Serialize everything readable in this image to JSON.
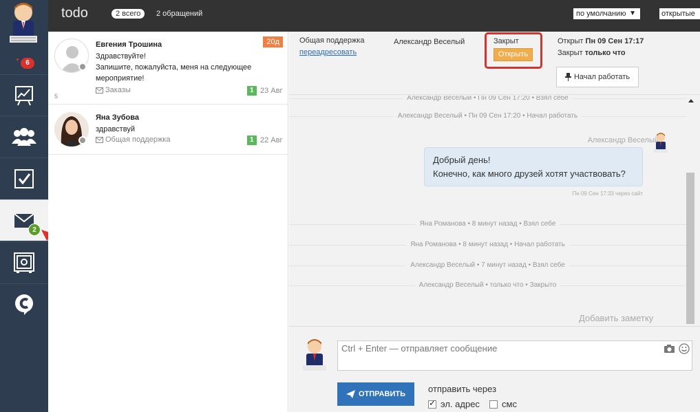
{
  "sidebar": {
    "notifications": "6",
    "mail_badge": "2"
  },
  "topbar": {
    "title": "todo",
    "total_label": "2 всего",
    "requests_label": "2 обращений",
    "sort_value": "по умолчанию",
    "status_value": "открытые"
  },
  "conversations": [
    {
      "name": "Евгения Трошина",
      "message_line1": "Здравствуйте!",
      "message_line2": "Запишите, пожалуйста, меня на следующее мероприятие!",
      "queue": "Заказы",
      "age_tag": "20д",
      "count": "1",
      "date": "23 Авг",
      "small_number": "5"
    },
    {
      "name": "Яна Зубова",
      "message_line1": "здравствуй",
      "queue": "Общая поддержка",
      "count": "1",
      "date": "22 Авг"
    }
  ],
  "ticket": {
    "queue": "Общая поддержка",
    "redirect_link": "переадресовать",
    "assignee": "Александр Веселый",
    "status_label": "Закрыт",
    "open_button": "Открыть",
    "opened_prefix": "Открыт",
    "opened_value": "Пн 09 Сен 17:17",
    "closed_prefix": "Закрыт",
    "closed_value": "только что",
    "start_button": "Начал работать"
  },
  "timeline": {
    "events_top": [
      "Александр Веселый • Пн 09 Сен 17:20 • Взял себе",
      "Александр Веселый • Пн 09 Сен 17:20 • Начал работать"
    ],
    "message": {
      "author": "Александр Веселый",
      "line1": "Добрый день!",
      "line2": "Конечно, как много друзей хотят участвовать?",
      "meta": "Пн 09 Сен 17:33 через сайт"
    },
    "events_bottom": [
      "Яна Романова • 8 минут назад • Взял себе",
      "Яна Романова • 8 минут назад • Начал работать",
      "Александр Веселый • 7 минут назад • Взял себе",
      "Александр Веселый • только что • Закрыто"
    ],
    "add_note": "Добавить заметку"
  },
  "composer": {
    "placeholder": "Ctrl + Enter — отправляет сообщение",
    "send_button": "ОТПРАВИТЬ",
    "send_via_label": "отправить через",
    "channel_email": "эл. адрес",
    "channel_email_checked": true,
    "channel_sms": "смс",
    "channel_sms_checked": false
  },
  "colors": {
    "sidebar_bg": "#2e3d4f",
    "topbar_bg": "#333333",
    "accent_blue": "#3073b8",
    "open_button": "#f0ad4e",
    "highlight_red": "#d9312b",
    "count_green": "#5cb85c"
  }
}
